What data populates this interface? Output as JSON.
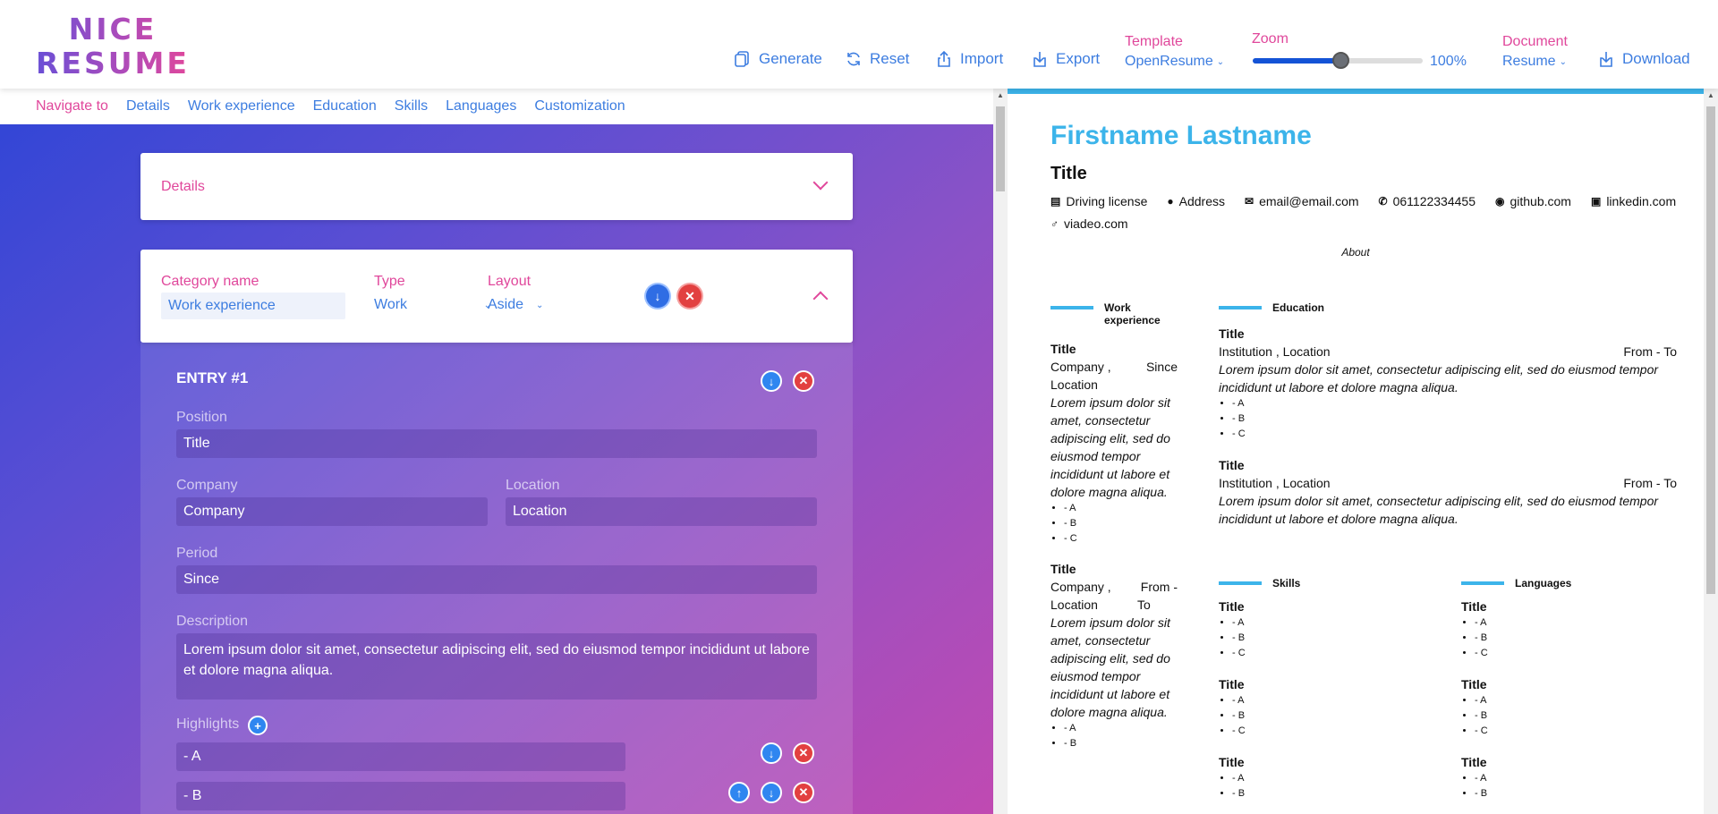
{
  "brand": {
    "line1": "NICE",
    "line2": "RESUME"
  },
  "toolbar": {
    "generate": "Generate",
    "reset": "Reset",
    "import": "Import",
    "export": "Export",
    "template_label": "Template",
    "template_value": "OpenResume",
    "zoom_label": "Zoom",
    "zoom_value": "100%",
    "document_label": "Document",
    "document_value": "Resume",
    "download": "Download"
  },
  "nav": {
    "label": "Navigate to",
    "items": [
      "Details",
      "Work experience",
      "Education",
      "Skills",
      "Languages",
      "Customization"
    ]
  },
  "details_card": {
    "title": "Details"
  },
  "category_card": {
    "name_label": "Category name",
    "name_value": "Work experience",
    "type_label": "Type",
    "type_value": "Work",
    "layout_label": "Layout",
    "layout_value": "Aside"
  },
  "entry": {
    "title": "ENTRY #1",
    "position_label": "Position",
    "position_value": "Title",
    "company_label": "Company",
    "company_value": "Company",
    "location_label": "Location",
    "location_value": "Location",
    "period_label": "Period",
    "period_value": "Since",
    "description_label": "Description",
    "description_value": "Lorem ipsum dolor sit amet, consectetur adipiscing elit, sed do eiusmod tempor incididunt ut labore et dolore magna aliqua.",
    "highlights_label": "Highlights",
    "highlights": [
      "- A",
      "- B"
    ]
  },
  "resume": {
    "name": "Firstname Lastname",
    "title": "Title",
    "contacts": [
      "Driving license",
      "Address",
      "email@email.com",
      "061122334455",
      "github.com",
      "linkedin.com",
      "viadeo.com"
    ],
    "about": "About",
    "work": {
      "heading": "Work experience",
      "entries": [
        {
          "title": "Title",
          "company": "Company ,",
          "period": "Since",
          "location": "Location",
          "desc": "Lorem ipsum dolor sit amet, consectetur adipiscing elit, sed do eiusmod tempor incididunt ut labore et dolore magna aliqua.",
          "bullets": [
            "- A",
            "- B",
            "- C"
          ]
        },
        {
          "title": "Title",
          "company": "Company ,",
          "period": "From -",
          "location": "Location",
          "period2": "To",
          "desc": "Lorem ipsum dolor sit amet, consectetur adipiscing elit, sed do eiusmod tempor incididunt ut labore et dolore magna aliqua.",
          "bullets": [
            "- A",
            "- B"
          ]
        }
      ]
    },
    "education": {
      "heading": "Education",
      "entries": [
        {
          "title": "Title",
          "place": "Institution , Location",
          "period": "From - To",
          "desc": "Lorem ipsum dolor sit amet, consectetur adipiscing elit, sed do eiusmod tempor incididunt ut labore et dolore magna aliqua.",
          "bullets": [
            "- A",
            "- B",
            "- C"
          ]
        },
        {
          "title": "Title",
          "place": "Institution , Location",
          "period": "From - To",
          "desc": "Lorem ipsum dolor sit amet, consectetur adipiscing elit, sed do eiusmod tempor incididunt ut labore et dolore magna aliqua."
        }
      ]
    },
    "skills": {
      "heading": "Skills",
      "groups": [
        {
          "title": "Title",
          "bullets": [
            "- A",
            "- B",
            "- C"
          ]
        },
        {
          "title": "Title",
          "bullets": [
            "- A",
            "- B",
            "- C"
          ]
        },
        {
          "title": "Title",
          "bullets": [
            "- A",
            "- B"
          ]
        }
      ]
    },
    "languages": {
      "heading": "Languages",
      "groups": [
        {
          "title": "Title",
          "bullets": [
            "- A",
            "- B",
            "- C"
          ]
        },
        {
          "title": "Title",
          "bullets": [
            "- A",
            "- B",
            "- C"
          ]
        },
        {
          "title": "Title",
          "bullets": [
            "- A",
            "- B"
          ]
        }
      ]
    }
  }
}
